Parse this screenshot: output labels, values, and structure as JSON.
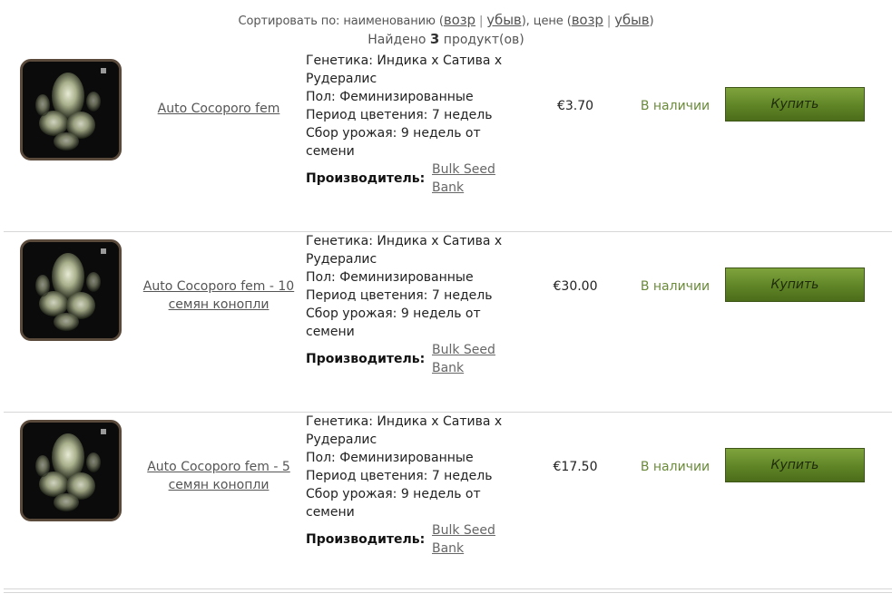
{
  "sort": {
    "prefix": "Сортировать по: наименованию (",
    "asc_label": "возр",
    "sep": "|",
    "desc_label": "убыв",
    "middle": "), цене (",
    "suffix": ")"
  },
  "found": {
    "before": "Найдено ",
    "count": "3",
    "after": " продукт(ов)"
  },
  "products": [
    {
      "name_l1": "Auto Cocoporo fem",
      "name_l2": "",
      "desc": [
        "Генетика: Индика x Сатива x",
        "Рудералис",
        "Пол: Феминизированные",
        "Период цветения: 7 недель",
        "Сбор урожая: 9 недель от",
        "семени"
      ],
      "mfr_label": "Производитель:",
      "mfr_l1": "Bulk Seed",
      "mfr_l2": "Bank",
      "price": "€3.70",
      "stock": "В наличии",
      "buy_label": "Купить"
    },
    {
      "name_l1": "Auto Cocoporo fem - 10",
      "name_l2": "семян конопли",
      "desc": [
        "Генетика: Индика x Сатива x",
        "Рудералис",
        "Пол: Феминизированные",
        "Период цветения: 7 недель",
        "Сбор урожая: 9 недель от",
        "семени"
      ],
      "mfr_label": "Производитель:",
      "mfr_l1": "Bulk Seed",
      "mfr_l2": "Bank",
      "price": "€30.00",
      "stock": "В наличии",
      "buy_label": "Купить"
    },
    {
      "name_l1": "Auto Cocoporo fem - 5",
      "name_l2": "семян конопли",
      "desc": [
        "Генетика: Индика x Сатива x",
        "Рудералис",
        "Пол: Феминизированные",
        "Период цветения: 7 недель",
        "Сбор урожая: 9 недель от",
        "семени"
      ],
      "mfr_label": "Производитель:",
      "mfr_l1": "Bulk Seed",
      "mfr_l2": "Bank",
      "price": "€17.50",
      "stock": "В наличии",
      "buy_label": "Купить"
    }
  ],
  "colors": {
    "accent_green": "#6a8a3a",
    "button_green": "#5f8426",
    "link_gray": "#555555"
  },
  "icons": {
    "product_image": "cannabis-plant-photo"
  }
}
